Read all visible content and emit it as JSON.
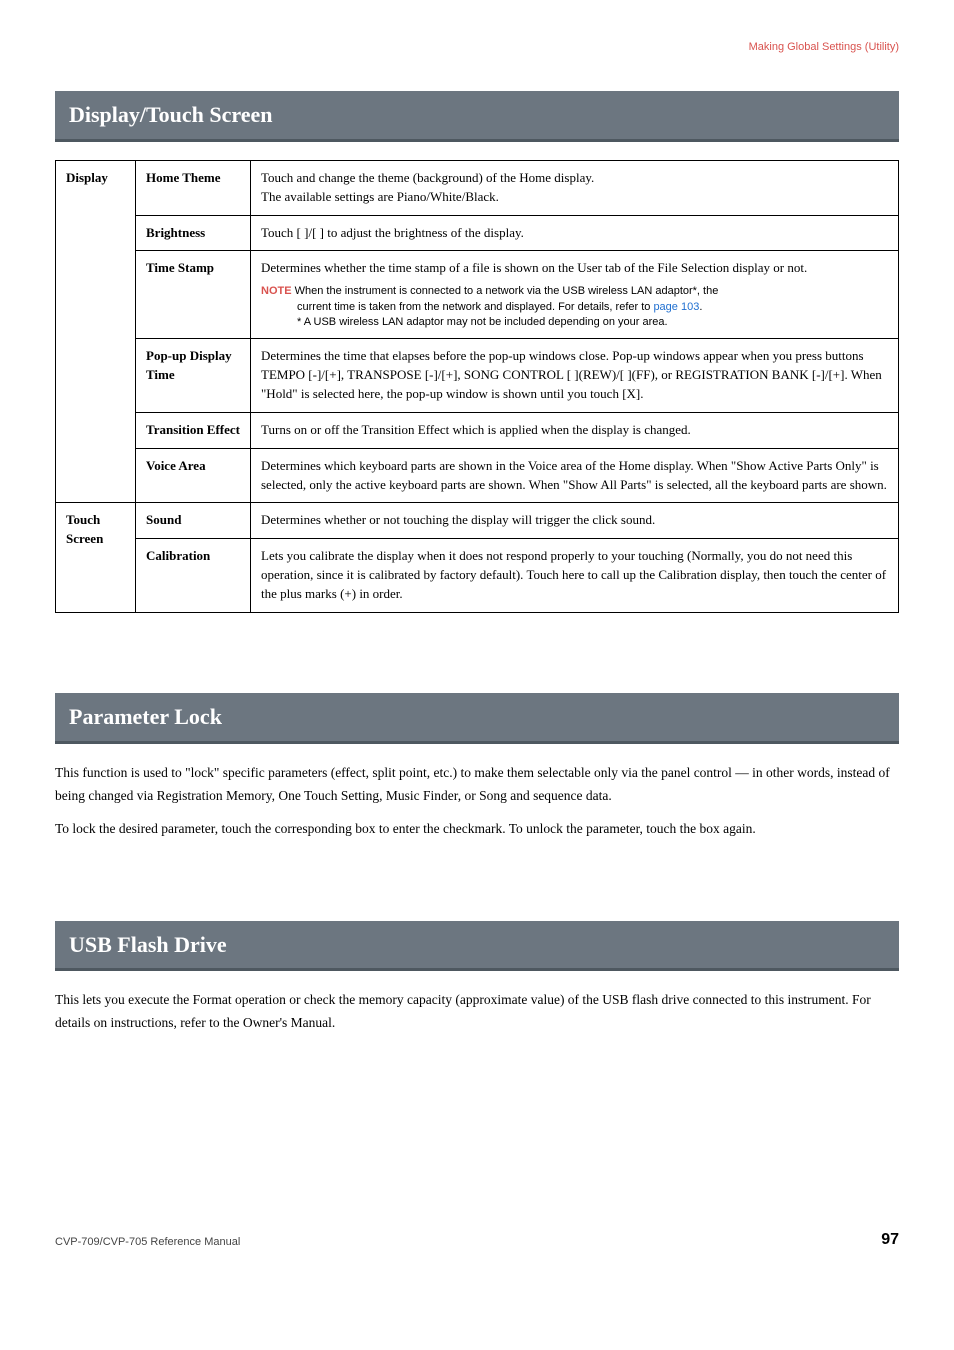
{
  "header": {
    "category": "Making Global Settings (Utility)"
  },
  "sections": {
    "display_touch_screen": {
      "title": "Display/Touch Screen"
    },
    "parameter_lock": {
      "title": "Parameter Lock",
      "p1": "This function is used to \"lock\" specific parameters (effect, split point, etc.) to make them selectable only via the panel control — in other words, instead of being changed via Registration Memory, One Touch Setting, Music Finder, or Song and sequence data.",
      "p2": "To lock the desired parameter, touch the corresponding box to enter the checkmark. To unlock the parameter, touch the box again."
    },
    "usb_flash_drive": {
      "title": "USB Flash Drive",
      "p1": "This lets you execute the Format operation or check the memory capacity (approximate value) of the USB flash drive connected to this instrument. For details on instructions, refer to the Owner's Manual."
    }
  },
  "table": {
    "display": {
      "label": "Display",
      "home_theme": {
        "label": "Home Theme",
        "desc": "Touch and change the theme (background) of the Home display.\nThe available settings are Piano/White/Black."
      },
      "brightness": {
        "label": "Brightness",
        "desc": "Touch [   ]/[   ] to adjust the brightness of the display."
      },
      "time_stamp": {
        "label": "Time Stamp",
        "desc": "Determines whether the time stamp of a file is shown on the User tab of the File Selection display or not.",
        "note_label": "NOTE",
        "note_l1": "When the instrument is connected to a network via the USB wireless LAN adaptor*, the",
        "note_l2a": "current time is taken from the network and displayed. For details, refer to ",
        "note_link": "page 103",
        "note_l2b": ".",
        "note_l3": "* A USB wireless LAN adaptor may not be included depending on your area."
      },
      "popup": {
        "label": "Pop-up Display Time",
        "desc": "Determines the time that elapses before the pop-up windows close. Pop-up windows appear when you press buttons TEMPO [-]/[+], TRANSPOSE [-]/[+], SONG CONTROL [       ](REW)/[       ](FF), or REGISTRATION BANK [-]/[+]. When \"Hold\" is selected here, the pop-up window is shown until you touch [X]."
      },
      "transition": {
        "label": "Transition Effect",
        "desc": "Turns on or off the Transition Effect which is applied when the display is changed."
      },
      "voice_area": {
        "label": "Voice Area",
        "desc": "Determines which keyboard parts are shown in the Voice area of the Home display. When \"Show Active Parts Only\" is selected, only the active keyboard parts are shown. When \"Show All Parts\" is selected, all the keyboard parts are shown."
      }
    },
    "touch_screen": {
      "label": "Touch Screen",
      "sound": {
        "label": "Sound",
        "desc": "Determines whether or not touching the display will trigger the click sound."
      },
      "calibration": {
        "label": "Calibration",
        "desc": "Lets you calibrate the display when it does not respond properly to your touching (Normally, you do not need this operation, since it is calibrated by factory default). Touch here to call up the Calibration display, then touch the center of the plus marks (+) in order."
      }
    }
  },
  "footer": {
    "ref": "CVP-709/CVP-705 Reference Manual",
    "page": "97"
  }
}
